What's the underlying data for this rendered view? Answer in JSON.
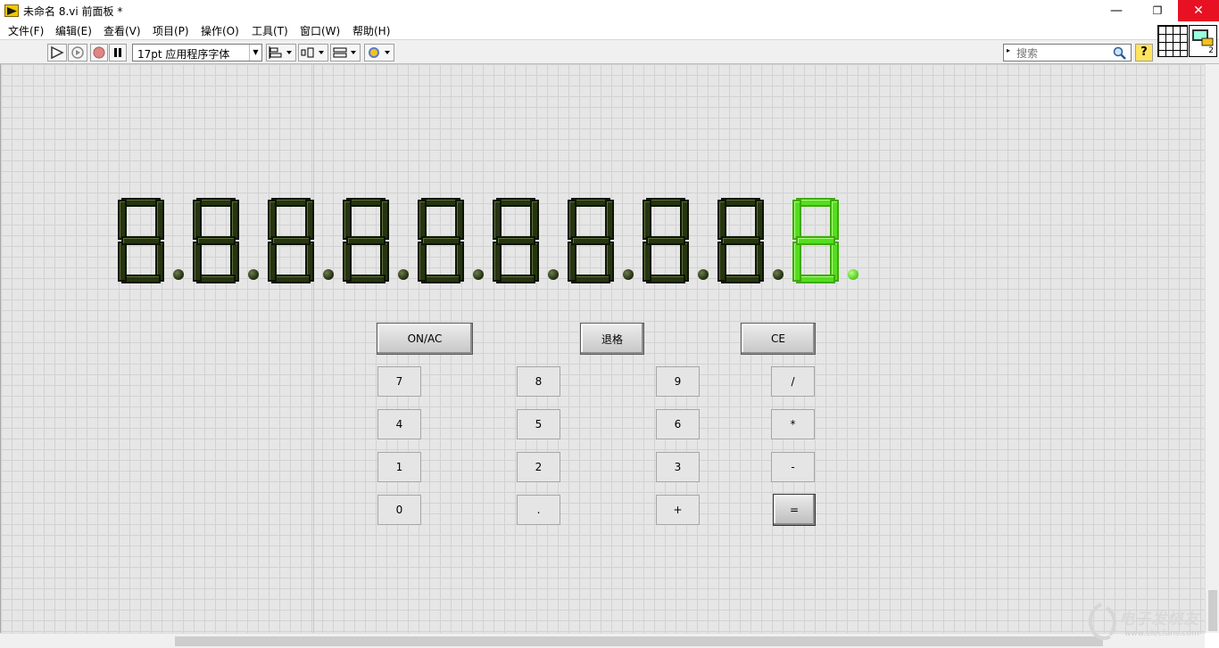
{
  "window": {
    "title": "未命名 8.vi 前面板 *",
    "minimize_glyph": "—",
    "restore_glyph": "❐",
    "close_glyph": "✕"
  },
  "menu": [
    "文件(F)",
    "编辑(E)",
    "查看(V)",
    "项目(P)",
    "操作(O)",
    "工具(T)",
    "窗口(W)",
    "帮助(H)"
  ],
  "toolbar": {
    "font_select": "17pt 应用程序字体",
    "search_placeholder": "搜索",
    "help_label": "?",
    "vi_icon_number": "2"
  },
  "icons": [
    "run-arrow-icon",
    "run-continuously-icon",
    "abort-icon",
    "pause-icon",
    "align-icon",
    "distribute-icon",
    "resize-icon",
    "reorder-icon",
    "search-icon",
    "help-icon",
    "connector-pane-icon",
    "vi-icon"
  ],
  "display": {
    "digit_count": 10,
    "lit_digit_index": 9,
    "off_color": "#26350f",
    "lit_color": "#55dd1f"
  },
  "keypad": {
    "on_ac": "ON/AC",
    "backspace": "退格",
    "ce": "CE",
    "k7": "7",
    "k8": "8",
    "k9": "9",
    "div": "/",
    "k4": "4",
    "k5": "5",
    "k6": "6",
    "mul": "*",
    "k1": "1",
    "k2": "2",
    "k3": "3",
    "sub": "-",
    "k0": "0",
    "dot": ".",
    "add": "+",
    "eq": "="
  },
  "watermark": {
    "text": "电子发烧友",
    "url": "www.elecfans.com"
  }
}
